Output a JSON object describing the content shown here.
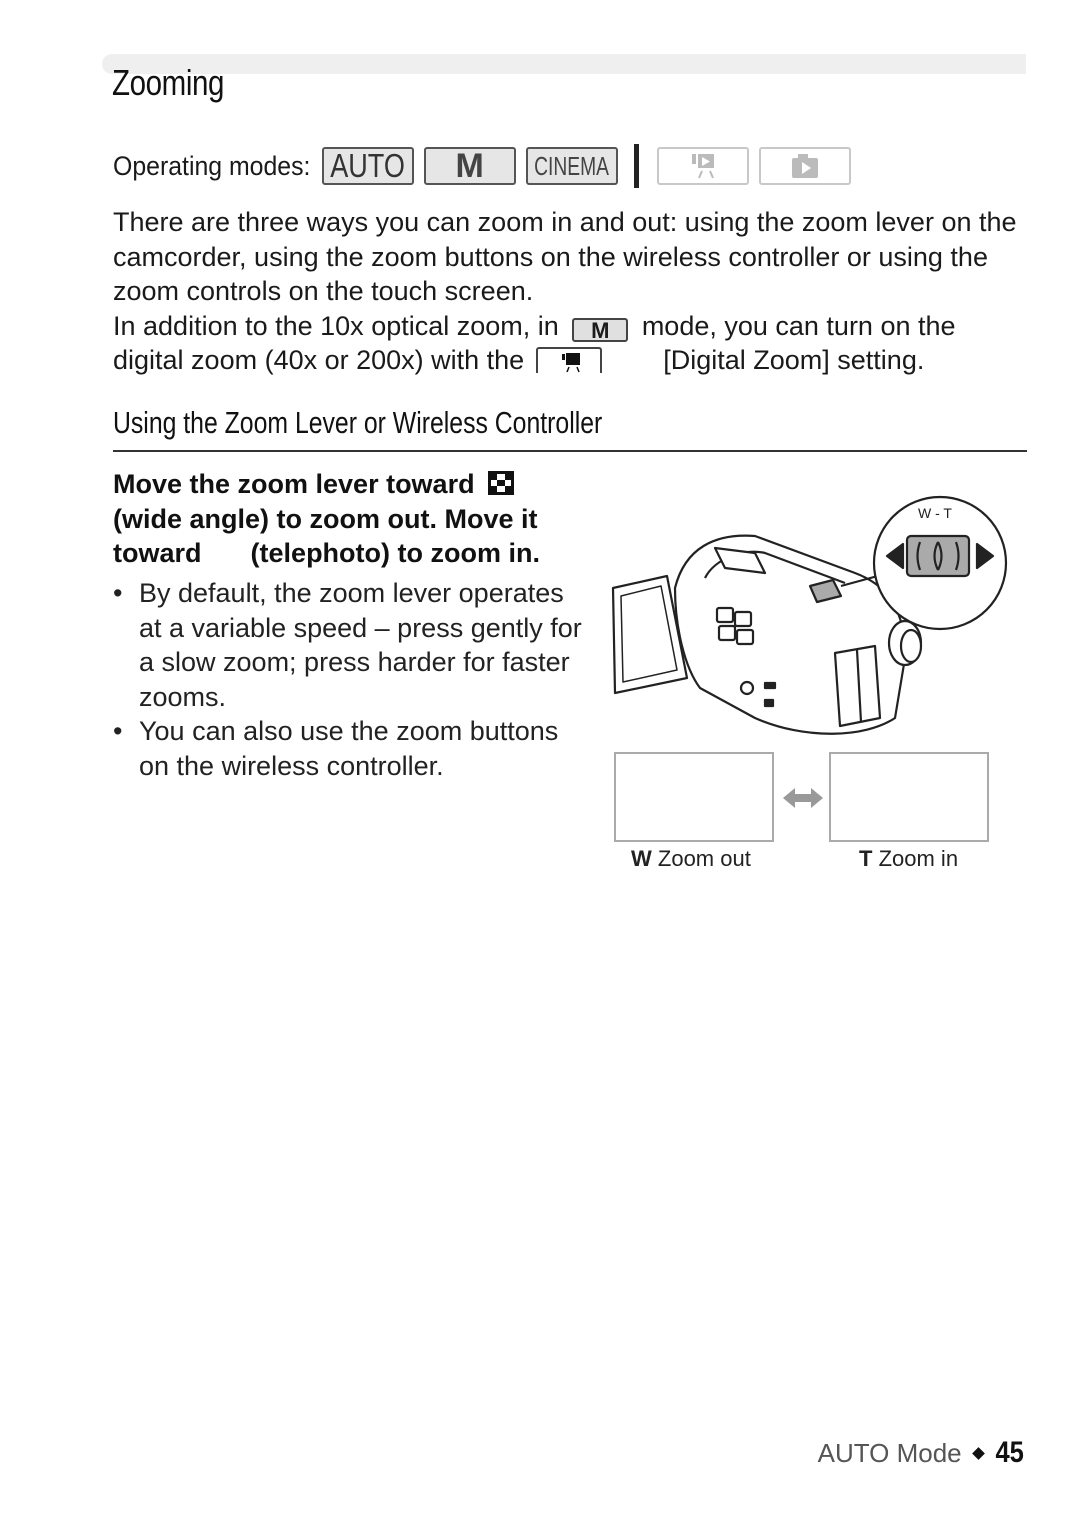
{
  "section": {
    "title": "Zooming"
  },
  "operating_modes": {
    "label": "Operating modes:",
    "modes": [
      {
        "label": "AUTO",
        "icon": "auto-mode-icon",
        "active": true
      },
      {
        "label": "M",
        "icon": "manual-mode-icon",
        "active": true
      },
      {
        "label": "CINEMA",
        "icon": "cinema-mode-icon",
        "active": true
      },
      {
        "label": "",
        "icon": "movie-playback-icon",
        "active": false
      },
      {
        "label": "",
        "icon": "photo-playback-icon",
        "active": false
      }
    ]
  },
  "intro": {
    "line1": "There are three ways you can zoom in and out: using the zoom lever on the camcorder, using the zoom buttons on the wireless controller or using the zoom controls on the touch screen.",
    "line2_a": "In addition to the 10x optical zoom, in",
    "line2_mode": "M",
    "line2_b": "mode, you can turn on the digital zoom (40x or 200x) with the",
    "line2_c": "[Digital Zoom] setting."
  },
  "subsection": {
    "title": "Using the Zoom Lever or Wireless Controller"
  },
  "step": {
    "text_a": "Move the zoom lever toward",
    "text_b": "(wide angle) to zoom out. Move it toward",
    "text_c": "(telephoto) to zoom in."
  },
  "bullets": [
    "By default, the zoom lever operates at a variable speed – press gently for a slow zoom; press harder for faster zooms.",
    "You can also use the zoom buttons on the wireless controller."
  ],
  "illustration": {
    "lever_label": "W - T",
    "wide_key": "W",
    "wide_caption": "Zoom out",
    "tele_key": "T",
    "tele_caption": "Zoom in"
  },
  "footer": {
    "chapter": "AUTO Mode",
    "page": "45"
  }
}
